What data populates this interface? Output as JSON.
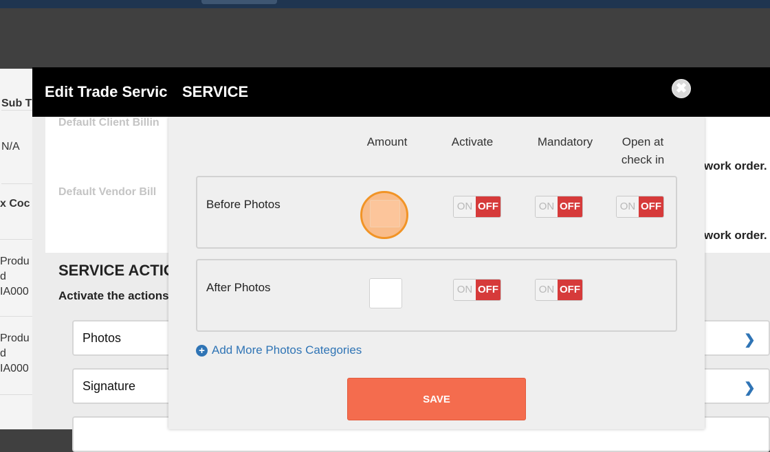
{
  "bg_table": {
    "header": "Sub T",
    "rows": [
      {
        "lines": [
          "N/A"
        ]
      },
      {
        "lines": [
          "x Coc"
        ]
      },
      {
        "lines": [
          "Produ",
          "d",
          "IA000"
        ]
      },
      {
        "lines": [
          "Produ",
          "d",
          "IA000"
        ]
      }
    ]
  },
  "outer_modal": {
    "title": "Edit Trade Servic",
    "default_client_billing": "Default Client Billin",
    "default_vendor_billing": "Default Vendor Bill",
    "right_text_1": "work order.",
    "right_text_2": "work order.",
    "section_title": "SERVICE ACTIO",
    "section_subtitle": "Activate the actions",
    "actions": [
      {
        "label": "Photos",
        "icon": "chevron-right-icon"
      },
      {
        "label": "Signature",
        "icon": "chevron-right-icon"
      }
    ]
  },
  "inner_modal": {
    "title": "SERVICE",
    "close_icon": "close-icon",
    "columns": [
      "Amount",
      "Activate",
      "Mandatory",
      "Open at check in"
    ],
    "rows": [
      {
        "label": "Before Photos",
        "amount": "",
        "toggles": [
          "OFF",
          "OFF",
          "OFF"
        ]
      },
      {
        "label": "After Photos",
        "amount": "",
        "toggles": [
          "OFF",
          "OFF"
        ]
      }
    ],
    "toggle_on_label": "ON",
    "toggle_off_label": "OFF",
    "add_more_label": "Add More Photos Categories",
    "save_label": "SAVE"
  },
  "colors": {
    "accent_blue": "#2f74b5",
    "toggle_off_red": "#d63a3a",
    "save_orange": "#f46c4e",
    "highlight_orange": "#f19426"
  }
}
